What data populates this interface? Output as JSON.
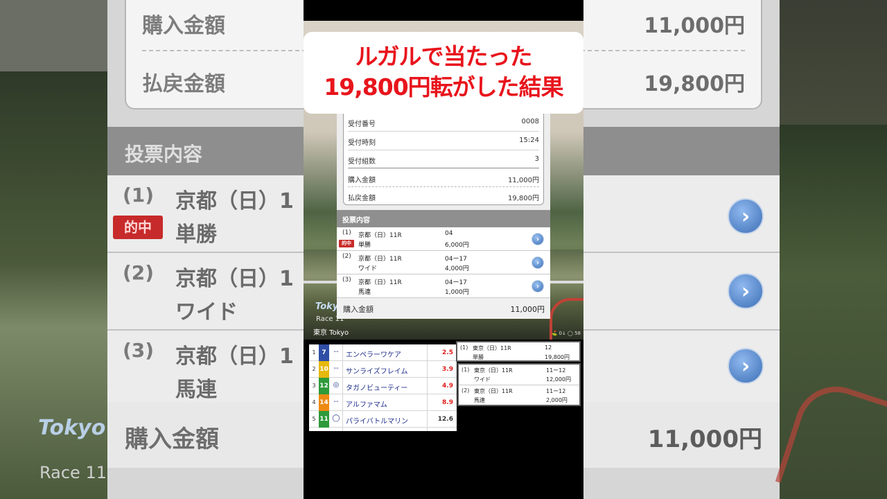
{
  "headline": {
    "line1": "ルガルで当たった",
    "line2": "19,800円転がした結果"
  },
  "ticket": {
    "info": [
      {
        "label": "受付番号",
        "value": "0008"
      },
      {
        "label": "受付時刻",
        "value": "15:24"
      },
      {
        "label": "受付組数",
        "value": "3"
      },
      {
        "label": "購入金額",
        "value": "11,000円"
      },
      {
        "label": "払戻金額",
        "value": "19,800円"
      }
    ],
    "section_title": "投票内容",
    "bets": [
      {
        "no": "(1)",
        "venue": "京都（日）11R",
        "kind": "単勝",
        "combo": "04",
        "amount": "6,000円",
        "badge": "的中"
      },
      {
        "no": "(2)",
        "venue": "京都（日）11R",
        "kind": "ワイド",
        "combo": "04ー17",
        "amount": "4,000円"
      },
      {
        "no": "(3)",
        "venue": "京都（日）11R",
        "kind": "馬連",
        "combo": "04ー17",
        "amount": "1,000円"
      }
    ],
    "total_label": "購入金額",
    "total_value": "11,000円",
    "arrow_glyph": "›"
  },
  "broadcast": {
    "logo": "Tokyo",
    "race": "Race 11",
    "venue": "東京 Tokyo",
    "stats": "⛳ 0↓ ◯ 58"
  },
  "odds_table": {
    "rows": [
      {
        "rank": "1",
        "num": "7",
        "num_color": "#2f4ea5",
        "mark": "--",
        "name": "エンペラーワケア",
        "odds": "2.5",
        "odds_color": "#e01b1b"
      },
      {
        "rank": "2",
        "num": "10",
        "num_color": "#e6b80c",
        "mark": "--",
        "name": "サンライズフレイム",
        "odds": "3.9",
        "odds_color": "#e01b1b"
      },
      {
        "rank": "3",
        "num": "12",
        "num_color": "#2e9a3a",
        "mark": "◎",
        "name": "タガノビューティー",
        "odds": "4.9",
        "odds_color": "#e01b1b"
      },
      {
        "rank": "4",
        "num": "14",
        "num_color": "#ee8a12",
        "mark": "--",
        "name": "アルファマム",
        "odds": "8.9",
        "odds_color": "#e01b1b"
      },
      {
        "rank": "5",
        "num": "11",
        "num_color": "#2e9a3a",
        "mark": "◯",
        "name": "パライバトルマリン",
        "odds": "12.6",
        "odds_color": "#333333"
      }
    ]
  },
  "result_cards": {
    "top": {
      "no": "(1)",
      "venue": "東京（日）11R",
      "kind": "単勝",
      "combo": "12",
      "amount": "19,800円"
    },
    "bottom": [
      {
        "no": "(1)",
        "venue": "東京（日）11R",
        "kind": "ワイド",
        "combo": "11ー12",
        "amount": "12,000円"
      },
      {
        "no": "(2)",
        "venue": "東京（日）11R",
        "kind": "馬連",
        "combo": "11ー12",
        "amount": "2,000円"
      }
    ]
  },
  "background": {
    "rows": [
      {
        "label": "購入金額",
        "value": "11,000円"
      },
      {
        "label": "払戻金額",
        "value": "19,800円"
      }
    ],
    "section_title": "投票内容",
    "bets": [
      {
        "no": "(1)",
        "venue": "京都（日）1",
        "kind": "単勝",
        "badge": "的中"
      },
      {
        "no": "(2)",
        "venue": "京都（日）1",
        "kind": "ワイド"
      },
      {
        "no": "(3)",
        "venue": "京都（日）1",
        "kind": "馬連"
      }
    ],
    "total_label": "購入金額",
    "total_value": "11,000円",
    "logo": "Tokyo",
    "race": "Race 11"
  }
}
